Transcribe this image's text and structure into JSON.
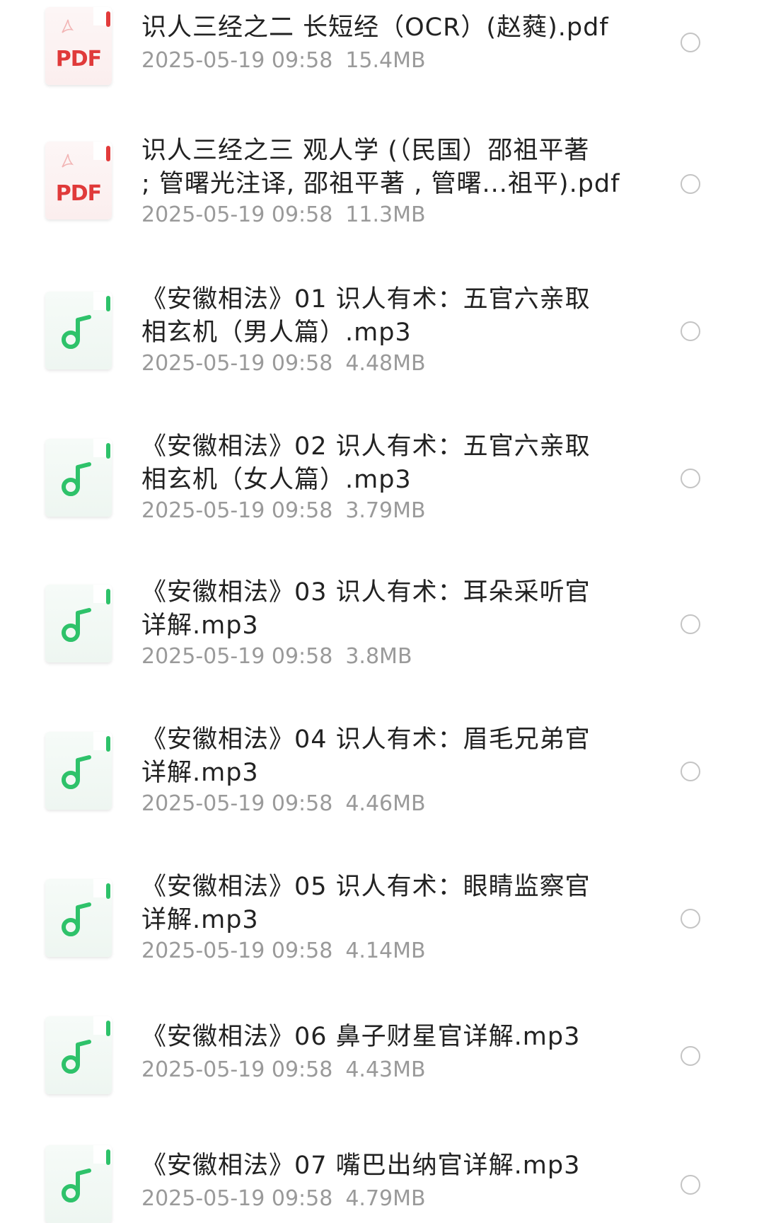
{
  "files": [
    {
      "type": "pdf",
      "icon": "pdf-file-icon",
      "icon_label": "PDF",
      "name_lines": [
        "识人三经之二 长短经（OCR）(赵蕤).pdf"
      ],
      "date": "2025-05-19 09:58",
      "size": "15.4MB"
    },
    {
      "type": "pdf",
      "icon": "pdf-file-icon",
      "icon_label": "PDF",
      "name_lines": [
        "识人三经之三 观人学 (（民国）邵祖平著",
        "; 管曙光注译, 邵祖平著 , 管曙...祖平).pdf"
      ],
      "date": "2025-05-19 09:58",
      "size": "11.3MB"
    },
    {
      "type": "audio",
      "icon": "music-note-icon",
      "name_lines": [
        "《安徽相法》01 识人有术：五官六亲取",
        "相玄机（男人篇）.mp3"
      ],
      "date": "2025-05-19 09:58",
      "size": "4.48MB"
    },
    {
      "type": "audio",
      "icon": "music-note-icon",
      "name_lines": [
        "《安徽相法》02 识人有术：五官六亲取",
        "相玄机（女人篇）.mp3"
      ],
      "date": "2025-05-19 09:58",
      "size": "3.79MB"
    },
    {
      "type": "audio",
      "icon": "music-note-icon",
      "name_lines": [
        "《安徽相法》03 识人有术：耳朵采听官",
        "详解.mp3"
      ],
      "date": "2025-05-19 09:58",
      "size": "3.8MB"
    },
    {
      "type": "audio",
      "icon": "music-note-icon",
      "name_lines": [
        "《安徽相法》04 识人有术：眉毛兄弟官",
        "详解.mp3"
      ],
      "date": "2025-05-19 09:58",
      "size": "4.46MB"
    },
    {
      "type": "audio",
      "icon": "music-note-icon",
      "name_lines": [
        "《安徽相法》05 识人有术：眼睛监察官",
        "详解.mp3"
      ],
      "date": "2025-05-19 09:58",
      "size": "4.14MB"
    },
    {
      "type": "audio",
      "icon": "music-note-icon",
      "name_lines": [
        "《安徽相法》06 鼻子财星官详解.mp3"
      ],
      "date": "2025-05-19 09:58",
      "size": "4.43MB"
    },
    {
      "type": "audio",
      "icon": "music-note-icon",
      "name_lines": [
        "《安徽相法》07 嘴巴出纳官详解.mp3"
      ],
      "date": "2025-05-19 09:58",
      "size": "4.79MB"
    }
  ],
  "colors": {
    "pdf_accent": "#e03a3a",
    "audio_accent": "#2ec26a",
    "meta_text": "#9a9a9a",
    "radio_border": "#c4c4c4"
  }
}
